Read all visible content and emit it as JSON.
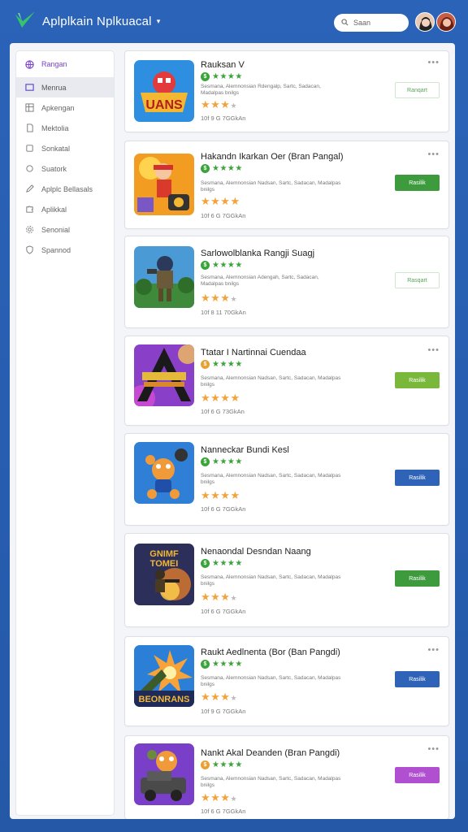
{
  "header": {
    "app_title": "Aplplkain Nplkuacal",
    "caret": "▾",
    "search_placeholder": "Saan",
    "logo_icon": "check-leaf-icon",
    "avatars": [
      "avatar-dark-hair",
      "avatar-red-hair"
    ]
  },
  "sidebar": {
    "items": [
      {
        "label": "Rangan",
        "icon": "globe-icon",
        "state": "heading"
      },
      {
        "label": "Menrua",
        "icon": "window-icon",
        "state": "active"
      },
      {
        "label": "Apkengan",
        "icon": "grid-icon",
        "state": "normal"
      },
      {
        "label": "Mektolia",
        "icon": "document-icon",
        "state": "normal"
      },
      {
        "label": "Sonkatal",
        "icon": "box-icon",
        "state": "normal"
      },
      {
        "label": "Suatork",
        "icon": "circle-icon",
        "state": "normal"
      },
      {
        "label": "Aplplc Bellasals",
        "icon": "pen-icon",
        "state": "normal"
      },
      {
        "label": "Aplikkal",
        "icon": "puzzle-icon",
        "state": "normal"
      },
      {
        "label": "Senonial",
        "icon": "settings-icon",
        "state": "normal"
      },
      {
        "label": "Spannod",
        "icon": "shield-icon",
        "state": "normal"
      }
    ]
  },
  "games": [
    {
      "title": "Rauksan V",
      "green_rating": 4,
      "badge_color": "#3aa33a",
      "description": "Sesmana, Alemnonsian Rdengalp, Sartc, Sadacan, Madalpas bnilgs",
      "stars": 3,
      "size": "10f  9 G 7GGkAn",
      "button_label": "Ranqart",
      "button_style": "outline",
      "button_color": "#58a558",
      "thumb": "brawl-logo"
    },
    {
      "title": "Hakandn Ikarkan Oer (Bran Pangal)",
      "green_rating": 4,
      "badge_color": "#3aa33a",
      "description": "Sesmana, Alemnonsian Nadsan, Sartc, Sadacan, Madalpas bnilgs",
      "stars": 4,
      "size": "10f  6 G 7GGkAn",
      "button_label": "Rasilik",
      "button_style": "solid",
      "button_color": "#3d9b3d",
      "thumb": "hero-red"
    },
    {
      "title": "Sarlowolblanka Rangji Suagj",
      "green_rating": 4,
      "badge_color": "#3aa33a",
      "description": "Sesmana, Alemnonsian Adengah, Sartc, Sadacan, Madalpas bnilgs",
      "stars": 3,
      "size": "10f  8 11 70GkAn",
      "button_label": "Rasqart",
      "button_style": "outline",
      "button_color": "#58a558",
      "thumb": "soldier-field"
    },
    {
      "title": "Ttatar I Nartinnai Cuendaa",
      "green_rating": 4,
      "badge_color": "#e8a032",
      "description": "Sesmana, Alemnonsian Nadsan, Sartc, Sadacan, Madalpas bnilgs",
      "stars": 4,
      "size": "10f  6 G 73GkAn",
      "button_label": "Rasilik",
      "button_style": "solid",
      "button_color": "#79b83a",
      "thumb": "purple-arrow"
    },
    {
      "title": "Nanneckar Bundi  Kesl",
      "green_rating": 4,
      "badge_color": "#3aa33a",
      "description": "Sesmana, Alemnonsian Nadsan, Sartc, Sadacan, Madalpas bnilgs",
      "stars": 4,
      "size": "10f  6 G 7GGkAn",
      "button_label": "Rasilik",
      "button_style": "solid",
      "button_color": "#2f63b8",
      "thumb": "orange-creature"
    },
    {
      "title": "Nenaondal Desndan Naang",
      "green_rating": 4,
      "badge_color": "#3aa33a",
      "description": "Sesmana, Alemnonsian Nadsan, Sartc, Sadacan, Madalpas bnilgs",
      "stars": 3,
      "size": "10f  6 G 7GGkAn",
      "button_label": "Rasilik",
      "button_style": "solid",
      "button_color": "#3d9b3d",
      "thumb": "battle-dark"
    },
    {
      "title": "Raukt Aedlnenta (Bor (Ban Pangdi)",
      "green_rating": 4,
      "badge_color": "#3aa33a",
      "description": "Sesmana, Alemnonsian Nadsan, Sartc, Sadacan, Madalpas bnilgs",
      "stars": 3,
      "size": "10f  9 G 7GGkAn",
      "button_label": "Rasilik",
      "button_style": "solid",
      "button_color": "#2f63b8",
      "thumb": "explosion"
    },
    {
      "title": "Nankt Akal  Deanden (Bran Pangdi)",
      "green_rating": 4,
      "badge_color": "#e8a032",
      "description": "Sesmana, Alemnonsian Nadsan, Sartc, Sadacan, Madalpas bnilgs",
      "stars": 3,
      "size": "10f  6 G 7GGkAn",
      "button_label": "Rasilik",
      "button_style": "solid",
      "button_color": "#b04fd0",
      "thumb": "truck-creature"
    }
  ]
}
